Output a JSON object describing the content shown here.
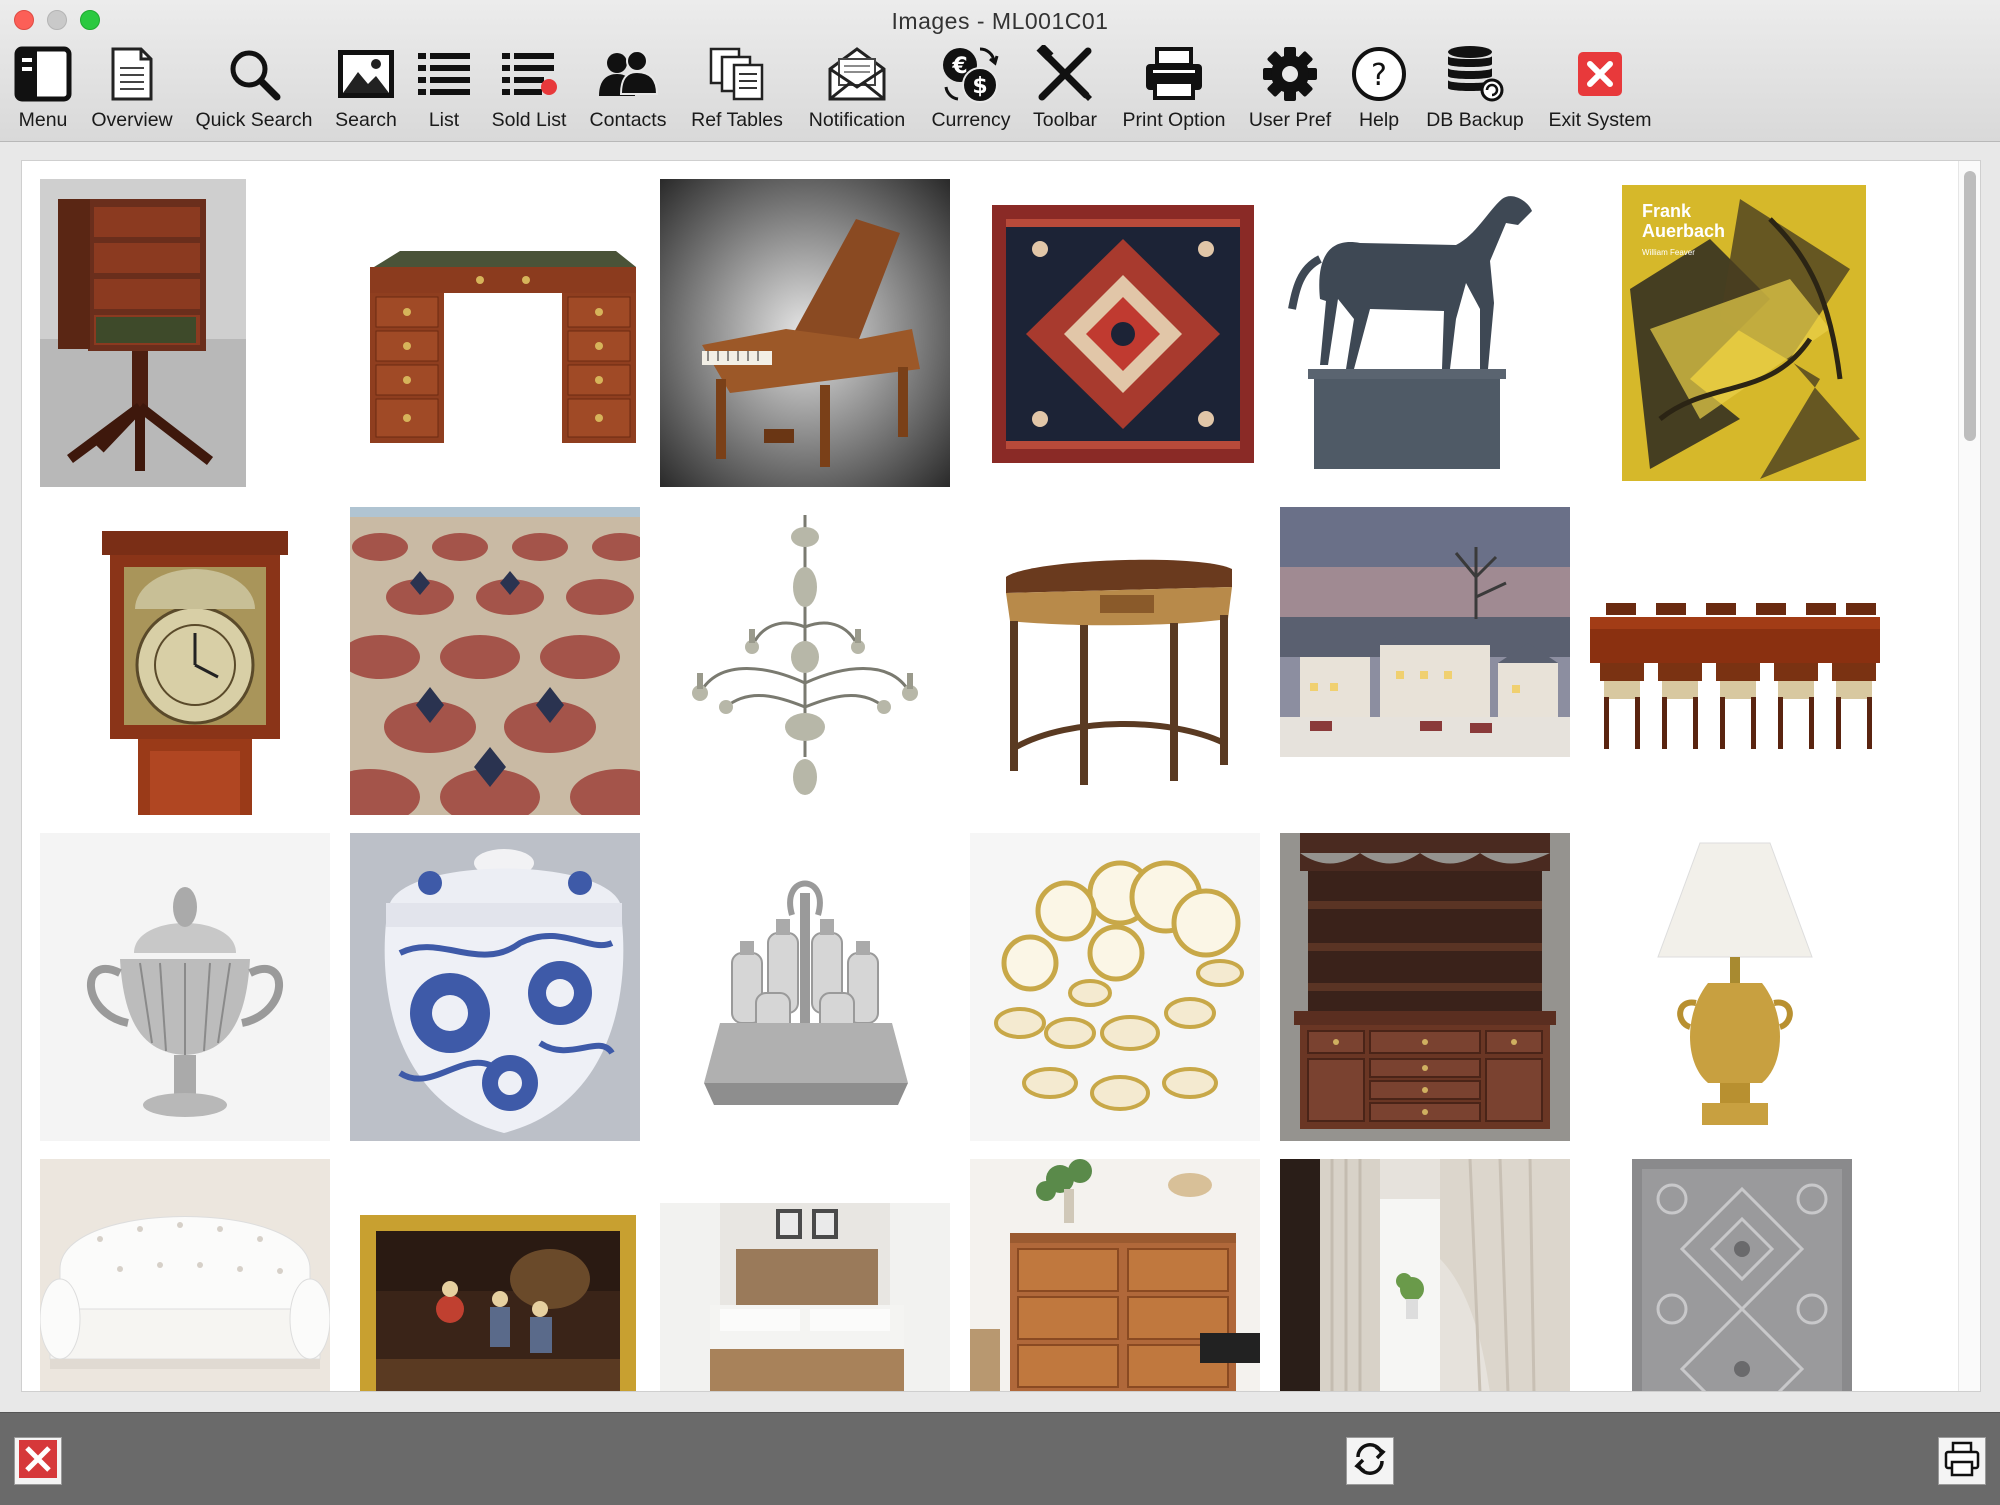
{
  "window": {
    "title": "Images - ML001C01"
  },
  "toolbar": {
    "items": [
      {
        "label": "Menu",
        "icon": "menu-icon"
      },
      {
        "label": "Overview",
        "icon": "overview-icon"
      },
      {
        "label": "Quick Search",
        "icon": "magnifier-icon"
      },
      {
        "label": "Search",
        "icon": "picture-icon"
      },
      {
        "label": "List",
        "icon": "list-icon"
      },
      {
        "label": "Sold List",
        "icon": "sold-list-icon"
      },
      {
        "label": "Contacts",
        "icon": "contacts-icon"
      },
      {
        "label": "Ref Tables",
        "icon": "ref-tables-icon"
      },
      {
        "label": "Notification",
        "icon": "envelope-icon"
      },
      {
        "label": "Currency",
        "icon": "currency-icon"
      },
      {
        "label": "Toolbar",
        "icon": "tools-icon"
      },
      {
        "label": "Print Option",
        "icon": "printer-icon"
      },
      {
        "label": "User Pref",
        "icon": "gear-icon"
      },
      {
        "label": "Help",
        "icon": "help-icon"
      },
      {
        "label": "DB Backup",
        "icon": "database-icon"
      },
      {
        "label": "Exit System",
        "icon": "exit-icon"
      }
    ]
  },
  "gallery": {
    "images": [
      {
        "name": "bookcase-image"
      },
      {
        "name": "pedestal-desk-image"
      },
      {
        "name": "grand-piano-image"
      },
      {
        "name": "persian-rug-image"
      },
      {
        "name": "horse-sculpture-image"
      },
      {
        "name": "book-cover-image",
        "text1": "Frank",
        "text2": "Auerbach",
        "text3": "William Feaver"
      },
      {
        "name": "longcase-clock-image"
      },
      {
        "name": "carpet-floor-image"
      },
      {
        "name": "chandelier-image"
      },
      {
        "name": "demilune-table-image"
      },
      {
        "name": "village-painting-image"
      },
      {
        "name": "dining-set-image"
      },
      {
        "name": "silver-cup-image"
      },
      {
        "name": "blue-white-jar-image"
      },
      {
        "name": "cruet-stand-image"
      },
      {
        "name": "gold-dinnerware-image"
      },
      {
        "name": "welsh-dresser-image"
      },
      {
        "name": "table-lamp-image"
      },
      {
        "name": "white-sofa-image"
      },
      {
        "name": "framed-painting-image"
      },
      {
        "name": "bed-image"
      },
      {
        "name": "dresser-image"
      },
      {
        "name": "curtains-image"
      },
      {
        "name": "grey-rug-image"
      }
    ]
  },
  "bottombar": {
    "close": "close-icon",
    "refresh": "refresh-icon",
    "print": "printer-icon"
  },
  "colors": {
    "exit_red": "#e8393b",
    "bottom_bar": "#6a6a6a",
    "close_red": "#d6383a"
  }
}
